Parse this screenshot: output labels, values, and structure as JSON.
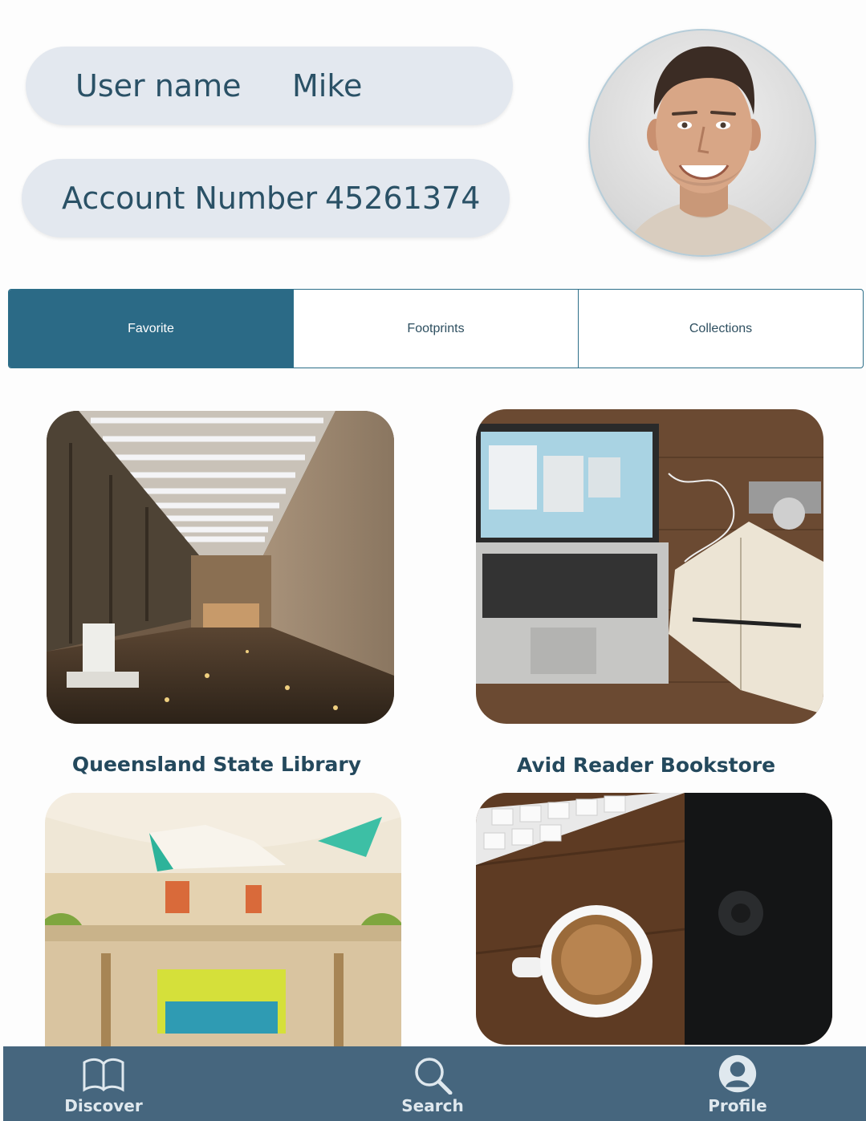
{
  "profile": {
    "username_label": "User name",
    "username_value": "Mike",
    "account_label": "Account Number",
    "account_value": "45261374"
  },
  "tabs": [
    {
      "label": "Favorite",
      "active": true
    },
    {
      "label": "Footprints",
      "active": false
    },
    {
      "label": "Collections",
      "active": false
    }
  ],
  "cards": [
    {
      "title": "Queensland State Library"
    },
    {
      "title": "Avid Reader Bookstore"
    }
  ],
  "bottom_nav": {
    "discover": "Discover",
    "search": "Search",
    "profile": "Profile"
  },
  "colors": {
    "accent": "#2b6a86",
    "pill_bg": "#e3e8ef",
    "text": "#24495d",
    "nav_bg": "#46667e"
  },
  "icons": {
    "discover": "book-icon",
    "search": "search-icon",
    "profile": "profile-icon"
  }
}
